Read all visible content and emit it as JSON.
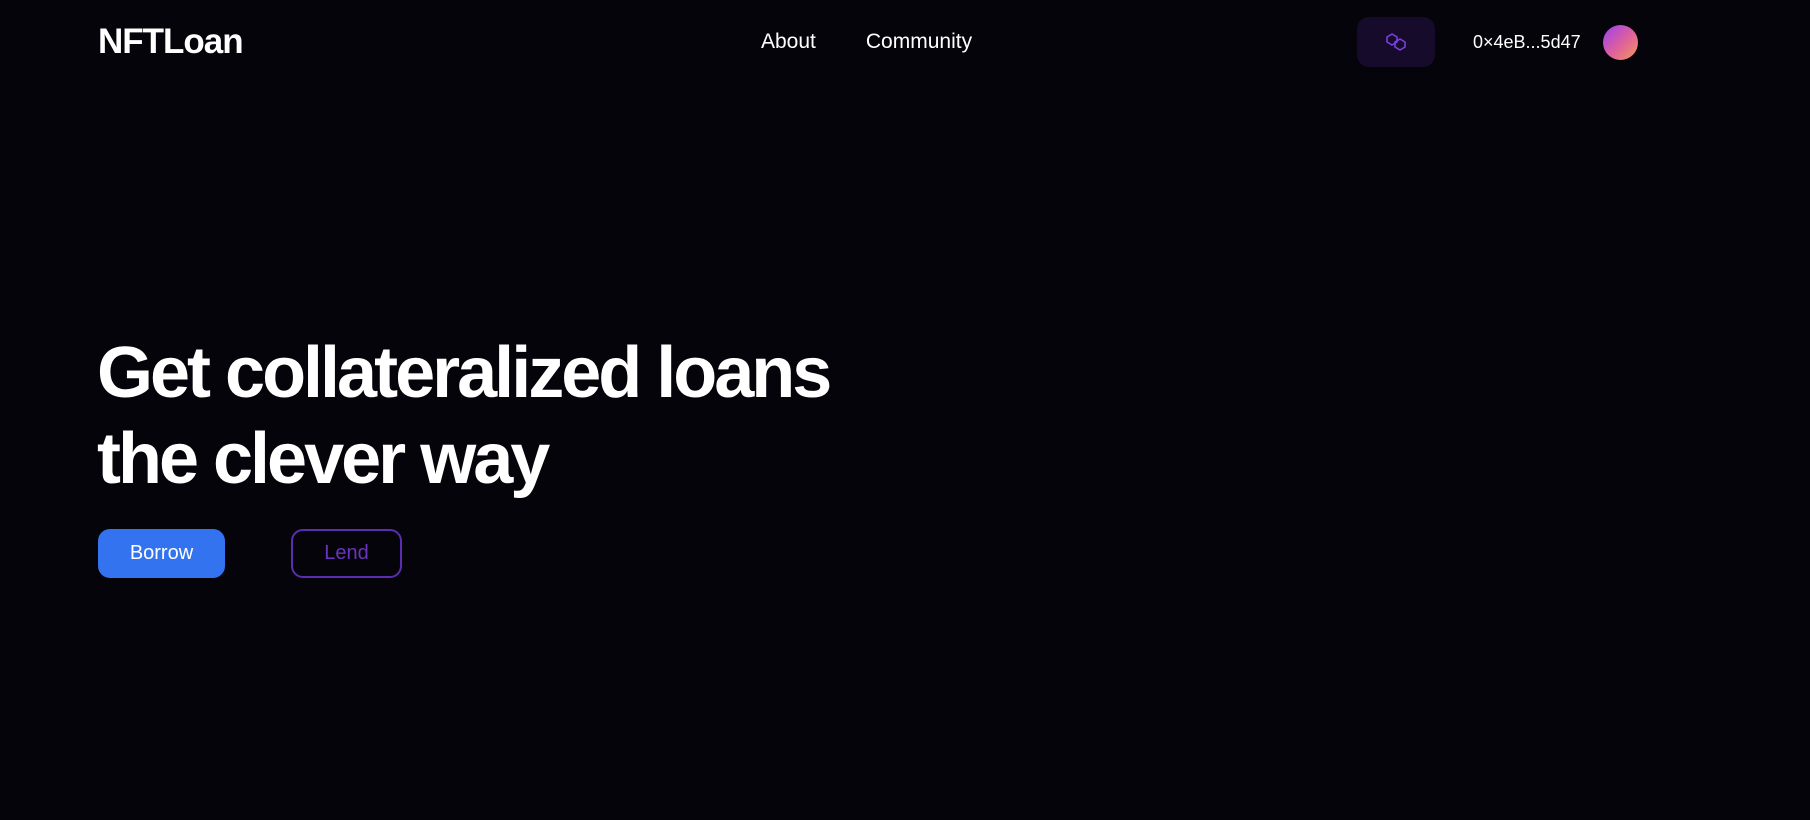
{
  "header": {
    "logo": "NFTLoan",
    "nav": [
      {
        "label": "About"
      },
      {
        "label": "Community"
      }
    ],
    "network_icon": "polygon-icon",
    "wallet_address": "0×4eB...5d47",
    "avatar": "gradient-avatar"
  },
  "hero": {
    "title_line1": "Get collateralized loans",
    "title_line2": "the clever way",
    "borrow_label": "Borrow",
    "lend_label": "Lend"
  },
  "colors": {
    "background": "#05040a",
    "primary": "#3373ef",
    "accent_purple": "#5b2db0",
    "network_button_bg": "#170b2b"
  }
}
